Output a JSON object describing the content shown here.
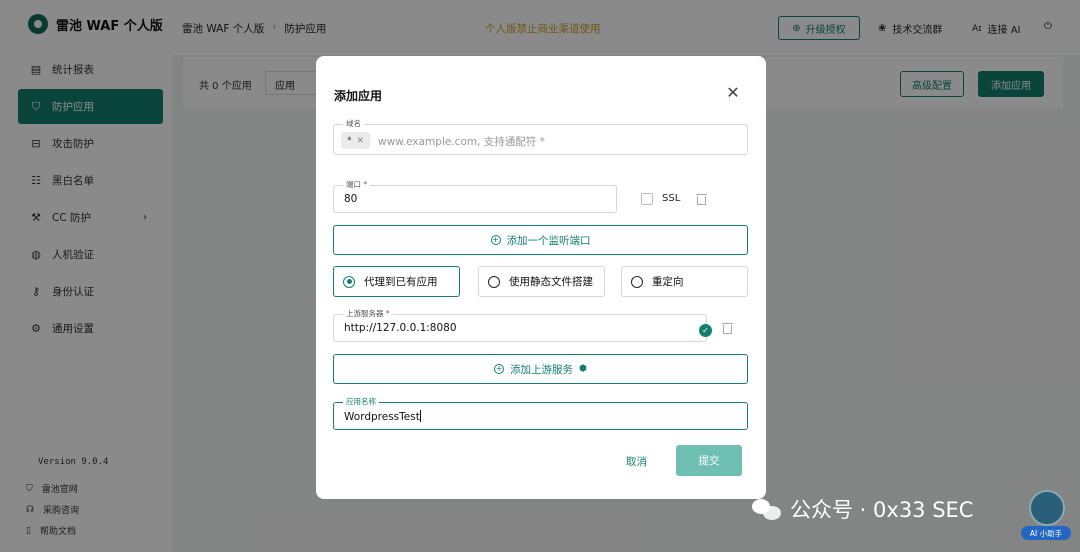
{
  "app": {
    "name": "雷池 WAF 个人版"
  },
  "sidebar": {
    "items": [
      {
        "label": "统计报表",
        "icon": "chart-icon"
      },
      {
        "label": "防护应用",
        "icon": "shield-icon",
        "active": true
      },
      {
        "label": "攻击防护",
        "icon": "attack-icon"
      },
      {
        "label": "黑白名单",
        "icon": "list-icon"
      },
      {
        "label": "CC 防护",
        "icon": "wrench-icon",
        "expandable": true
      },
      {
        "label": "人机验证",
        "icon": "robot-icon"
      },
      {
        "label": "身份认证",
        "icon": "key-icon"
      },
      {
        "label": "通用设置",
        "icon": "gear-icon"
      }
    ],
    "version": "Version 9.0.4",
    "footer": [
      {
        "label": "雷池官网",
        "icon": "shield-small-icon"
      },
      {
        "label": "采购咨询",
        "icon": "headset-icon"
      },
      {
        "label": "帮助文档",
        "icon": "doc-icon"
      }
    ]
  },
  "header": {
    "breadcrumb": [
      "雷池 WAF 个人版",
      "防护应用"
    ],
    "notice": "个人版禁止商业渠道使用",
    "upgrade": "升级授权",
    "community": "技术交流群",
    "ai": "连接 AI"
  },
  "toolbar": {
    "total": "共 0 个应用",
    "filter": "应用",
    "advanced": "高级配置",
    "add": "添加应用"
  },
  "modal": {
    "title": "添加应用",
    "domain": {
      "label": "域名",
      "chip": "*",
      "placeholder": "www.example.com, 支持通配符 *"
    },
    "port": {
      "label": "端口",
      "value": "80",
      "ssl_label": "SSL"
    },
    "add_port": "添加一个监听端口",
    "modes": [
      {
        "label": "代理到已有应用",
        "selected": true
      },
      {
        "label": "使用静态文件搭建",
        "selected": false
      },
      {
        "label": "重定向",
        "selected": false
      }
    ],
    "upstream": {
      "label": "上游服务器",
      "value": "http://127.0.0.1:8080"
    },
    "add_upstream": "添加上游服务",
    "app_name": {
      "label": "应用名称",
      "value": "WordpressTest"
    },
    "cancel": "取消",
    "submit": "提交"
  },
  "watermark": {
    "text": "公众号 · 0x33 SEC"
  },
  "assistant": {
    "label": "AI 小助手"
  },
  "colors": {
    "accent": "#13806f",
    "submit": "#6fbfb3",
    "notice": "#c9a227"
  }
}
